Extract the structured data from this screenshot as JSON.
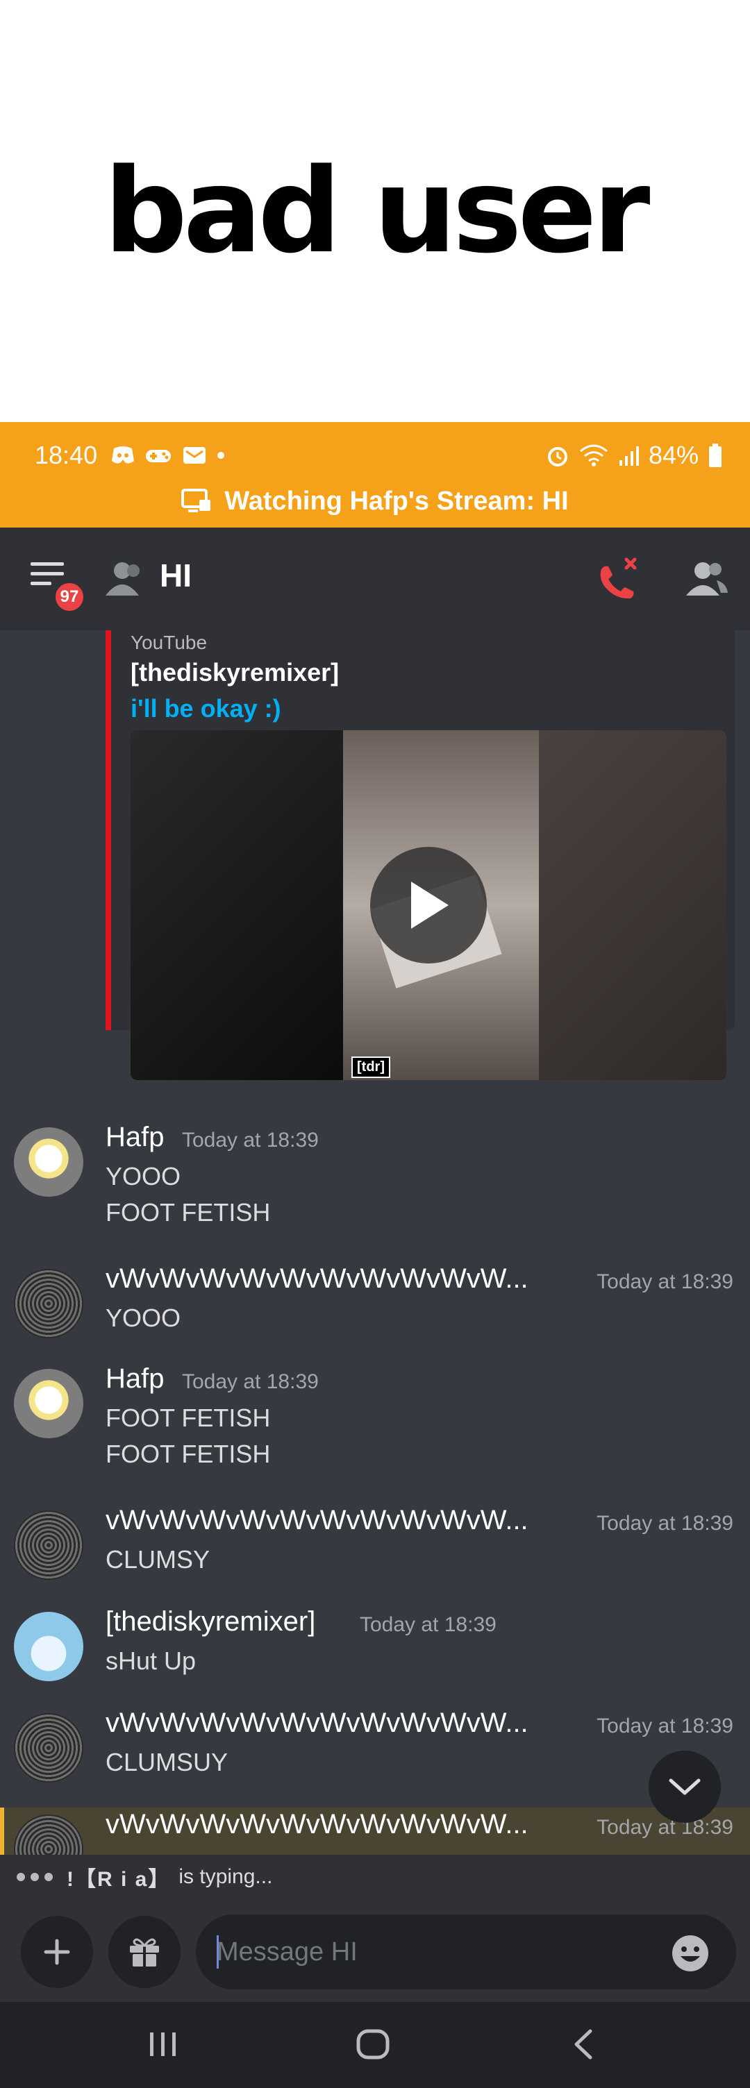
{
  "caption": {
    "text": "bad user"
  },
  "status_bar": {
    "time": "18:40",
    "battery": "84%"
  },
  "stream_banner": {
    "text": "Watching Hafp's Stream: HI"
  },
  "app_bar": {
    "unread_badge": "97",
    "channel_name": "HI"
  },
  "embed": {
    "provider": "YouTube",
    "author": "[thediskyremixer]",
    "title": "i'll be okay :)",
    "video_watermark": "[tdr]",
    "accent_color": "#e0141e"
  },
  "messages": [
    {
      "author": "Hafp",
      "timestamp": "Today at 18:39",
      "lines": [
        "YOOO",
        "FOOT FETISH"
      ]
    },
    {
      "author": "vWvWvWvWvWvWvWvWvWvW...",
      "timestamp": "Today at 18:39",
      "lines": [
        "YOOO"
      ]
    },
    {
      "author": "Hafp",
      "timestamp": "Today at 18:39",
      "lines": [
        "FOOT FETISH",
        "FOOT FETISH"
      ]
    },
    {
      "author": "vWvWvWvWvWvWvWvWvWvW...",
      "timestamp": "Today at 18:39",
      "lines": [
        "CLUMSY"
      ]
    },
    {
      "author": "[thediskyremixer]",
      "timestamp": "Today at 18:39",
      "lines": [
        "sHut Up"
      ]
    },
    {
      "author": "vWvWvWvWvWvWvWvWvWvW...",
      "timestamp": "Today at 18:39",
      "lines": [
        "CLUMSUY"
      ]
    },
    {
      "author": "vWvWvWvWvWvWvWvWvWvW...",
      "timestamp": "Today at 18:39",
      "lines": []
    }
  ],
  "typing": {
    "user": "!【R i a】",
    "suffix": "is typing..."
  },
  "composer": {
    "placeholder": "Message HI"
  },
  "colors": {
    "status_bar": "#f6a11a",
    "background": "#36393f",
    "link": "#00b0f4",
    "badge": "#ed4245",
    "hangup": "#ed4245"
  }
}
